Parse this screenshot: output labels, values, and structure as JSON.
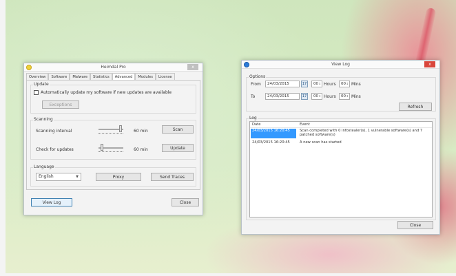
{
  "heimdal": {
    "title": "Heimdal Pro",
    "close_glyph": "x",
    "tabs": [
      {
        "label": "Overview"
      },
      {
        "label": "Software"
      },
      {
        "label": "Malware"
      },
      {
        "label": "Statistics"
      },
      {
        "label": "Advanced",
        "active": true
      },
      {
        "label": "Modules"
      },
      {
        "label": "License"
      }
    ],
    "update": {
      "group_label": "Update",
      "auto_update_label": "Automatically update my software if new updates are available",
      "auto_update_checked": false,
      "exceptions_button": "Exceptions"
    },
    "scanning": {
      "group_label": "Scanning",
      "interval_label": "Scanning interval",
      "interval_value": "60 min",
      "interval_slider_fraction": 0.95,
      "scan_button": "Scan",
      "check_label": "Check for updates",
      "check_value": "60 min",
      "check_slider_fraction": 0.08,
      "update_button": "Update"
    },
    "language": {
      "group_label": "Language",
      "selected": "English",
      "proxy_button": "Proxy",
      "send_traces_button": "Send Traces"
    },
    "view_log_button": "View Log",
    "close_button": "Close"
  },
  "viewlog": {
    "title": "View Log",
    "close_glyph": "x",
    "options": {
      "group_label": "Options",
      "from_label": "From",
      "from_date": "24/03/2015",
      "from_hours_value": "00",
      "from_mins_value": "00",
      "to_label": "To",
      "to_date": "24/03/2015",
      "to_hours_value": "00",
      "to_mins_value": "00",
      "hours_label": "Hours",
      "mins_label": "Mins",
      "calendar_glyph": "17",
      "refresh_button": "Refresh"
    },
    "log": {
      "group_label": "Log",
      "col_date": "Date",
      "col_event": "Event",
      "rows": [
        {
          "date": "24/03/2015 16:20:45",
          "event": "Scan completed with 0 infostealer(s), 1 vulnerable software(s) and 7 patched software(s)",
          "selected": true
        },
        {
          "date": "24/03/2015 16:20:45",
          "event": "A new scan has started",
          "selected": false
        }
      ]
    },
    "close_button": "Close"
  },
  "colors": {
    "selection": "#3399ff",
    "close_red": "#d9463b",
    "heimdal_icon": "#f0d23c",
    "viewlog_icon": "#2c7bd9"
  }
}
